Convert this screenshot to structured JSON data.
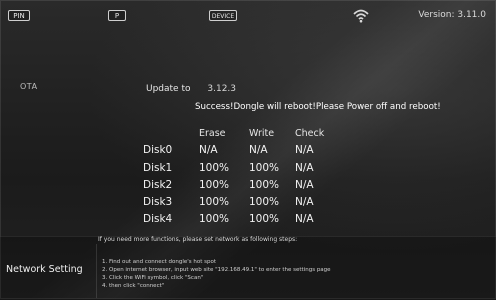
{
  "topbar": {
    "pin_label": "PIN",
    "p_label": "P",
    "device_label": "DEVICE",
    "version_text": "Version: 3.11.0"
  },
  "sidebar": {
    "ota_label": "OTA"
  },
  "update": {
    "label": "Update to",
    "version": "3.12.3",
    "message": "Success!Dongle will reboot!Please Power off and reboot!"
  },
  "table": {
    "headers": {
      "erase": "Erase",
      "write": "Write",
      "check": "Check"
    },
    "rows": [
      {
        "disk": "Disk0",
        "erase": "N/A",
        "write": "N/A",
        "check": "N/A"
      },
      {
        "disk": "Disk1",
        "erase": "100%",
        "write": "100%",
        "check": "N/A"
      },
      {
        "disk": "Disk2",
        "erase": "100%",
        "write": "100%",
        "check": "N/A"
      },
      {
        "disk": "Disk3",
        "erase": "100%",
        "write": "100%",
        "check": "N/A"
      },
      {
        "disk": "Disk4",
        "erase": "100%",
        "write": "100%",
        "check": "N/A"
      }
    ]
  },
  "network": {
    "title": "If you need more functions, please set network as following steps:",
    "label": "Network Setting",
    "steps": [
      "1. Find out and connect dongle's hot spot",
      "2. Open internet browser, input web site \"192.168.49.1\" to enter the settings page",
      "3. Click the WiFi symbol, click \"Scan\"",
      "4. then click \"connect\""
    ]
  },
  "colors": {
    "background": "#1f1f1f",
    "text": "#f2f2f2"
  },
  "icons": {
    "wifi": "wifi-icon"
  }
}
